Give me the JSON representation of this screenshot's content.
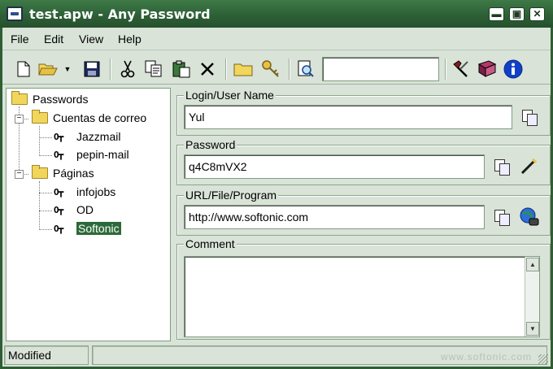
{
  "window": {
    "title": "test.apw - Any Password"
  },
  "titlebar_buttons": {
    "minimize": "▬",
    "maximize": "▣",
    "close": "✕"
  },
  "menu": [
    "File",
    "Edit",
    "View",
    "Help"
  ],
  "toolbar": {
    "icons": [
      "new-file-icon",
      "open-folder-icon",
      "dropdown-arrow-icon",
      "save-icon",
      "cut-icon",
      "copy-icon",
      "paste-icon",
      "delete-icon",
      "folder-icon",
      "key-icon",
      "find-icon",
      "tools-icon",
      "book-icon",
      "info-icon"
    ],
    "search_value": ""
  },
  "tree": {
    "root": "Passwords",
    "groups": [
      {
        "label": "Cuentas de correo",
        "items": [
          "Jazzmail",
          "pepin-mail"
        ]
      },
      {
        "label": "Páginas",
        "items": [
          "infojobs",
          "OD",
          "Softonic"
        ]
      }
    ],
    "selected": "Softonic"
  },
  "details": {
    "login_label": "Login/User Name",
    "login_value": "Yul",
    "password_label": "Password",
    "password_value": "q4C8mVX2",
    "url_label": "URL/File/Program",
    "url_value": "http://www.softonic.com",
    "comment_label": "Comment",
    "comment_value": ""
  },
  "status": {
    "left": "Modified",
    "watermark": "www.softonic.com"
  },
  "colors": {
    "titlebar": "#2c5e35",
    "selection": "#2c6a38",
    "chrome": "#d9e3d8"
  }
}
